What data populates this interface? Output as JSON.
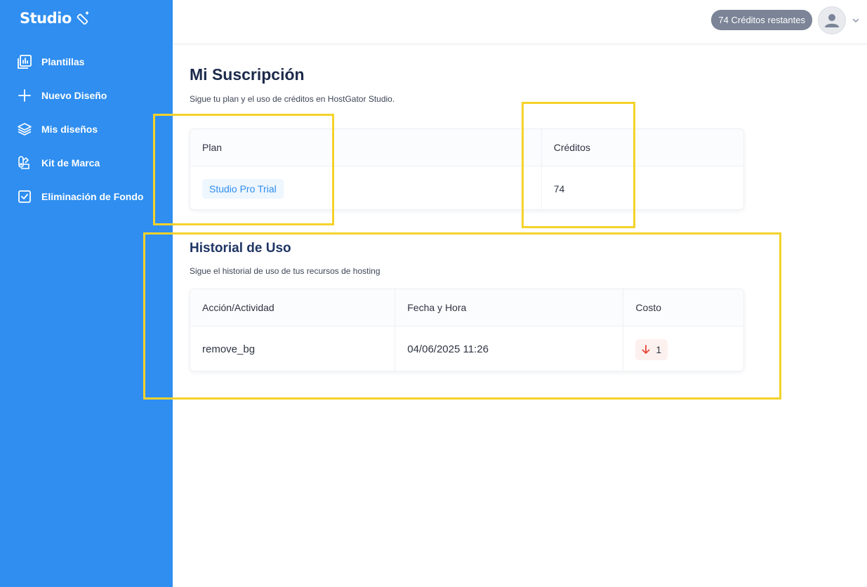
{
  "brand": {
    "name": "Studio"
  },
  "sidebar": {
    "items": [
      {
        "label": "Plantillas",
        "icon": "templates-icon"
      },
      {
        "label": "Nuevo Diseño",
        "icon": "plus-icon"
      },
      {
        "label": "Mis diseños",
        "icon": "layers-icon"
      },
      {
        "label": "Kit de Marca",
        "icon": "brand-kit-icon"
      },
      {
        "label": "Eliminación de Fondo",
        "icon": "checkbox-icon"
      }
    ]
  },
  "header": {
    "credits_label": "74 Créditos restantes"
  },
  "subscription": {
    "title": "Mi Suscripción",
    "subtitle": "Sigue tu plan y el uso de créditos en HostGator Studio.",
    "columns": {
      "plan": "Plan",
      "credits": "Créditos"
    },
    "plan_value": "Studio Pro Trial",
    "credits_value": "74"
  },
  "history": {
    "title": "Historial de Uso",
    "subtitle": "Sigue el historial de uso de tus recursos de hosting",
    "columns": {
      "action": "Acción/Actividad",
      "datetime": "Fecha y Hora",
      "cost": "Costo"
    },
    "rows": [
      {
        "action": "remove_bg",
        "datetime": "04/06/2025 11:26",
        "cost": "1"
      }
    ]
  },
  "colors": {
    "sidebar": "#2f8ef0",
    "highlight": "#f5d22a",
    "cost_arrow": "#e5483a"
  }
}
